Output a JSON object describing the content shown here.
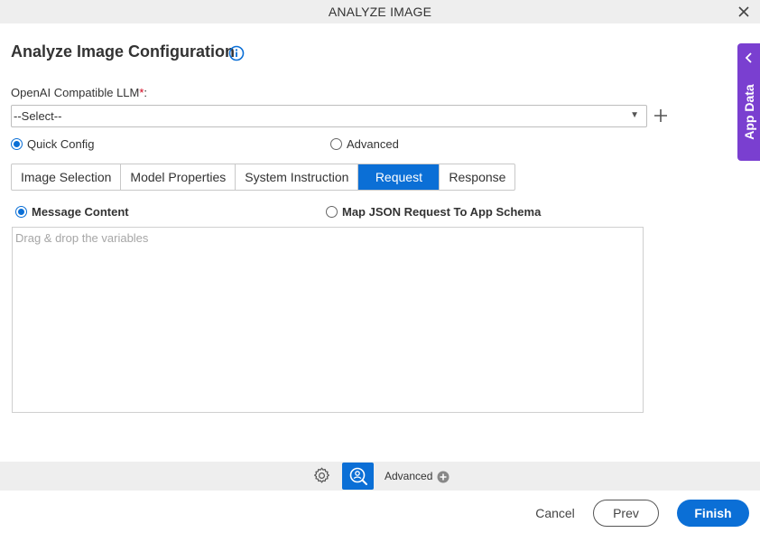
{
  "window": {
    "title": "ANALYZE IMAGE"
  },
  "page": {
    "heading": "Analyze Image Configuration"
  },
  "llm": {
    "label": "OpenAI Compatible LLM",
    "required_marker": "*",
    "label_suffix": ":",
    "selected": "--Select--"
  },
  "config_mode": {
    "options": [
      "Quick Config",
      "Advanced"
    ],
    "selected": "Quick Config"
  },
  "tabs": {
    "items": [
      "Image Selection",
      "Model Properties",
      "System Instruction",
      "Request",
      "Response"
    ],
    "active": "Request"
  },
  "request_mode": {
    "options": [
      "Message Content",
      "Map JSON Request To App Schema"
    ],
    "selected": "Message Content"
  },
  "message": {
    "placeholder": "Drag & drop the variables"
  },
  "side_panel": {
    "label": "App Data"
  },
  "toolbar": {
    "advanced_label": "Advanced"
  },
  "footer": {
    "cancel": "Cancel",
    "prev": "Prev",
    "finish": "Finish"
  },
  "colors": {
    "primary": "#0b6fd6",
    "side_panel": "#7a3fd0",
    "required": "#d0021b"
  },
  "icons": [
    "close-icon",
    "info-icon",
    "chevron-down-icon",
    "plus-icon",
    "chevron-left-icon",
    "gear-icon",
    "image-search-icon",
    "plus-circle-icon"
  ]
}
